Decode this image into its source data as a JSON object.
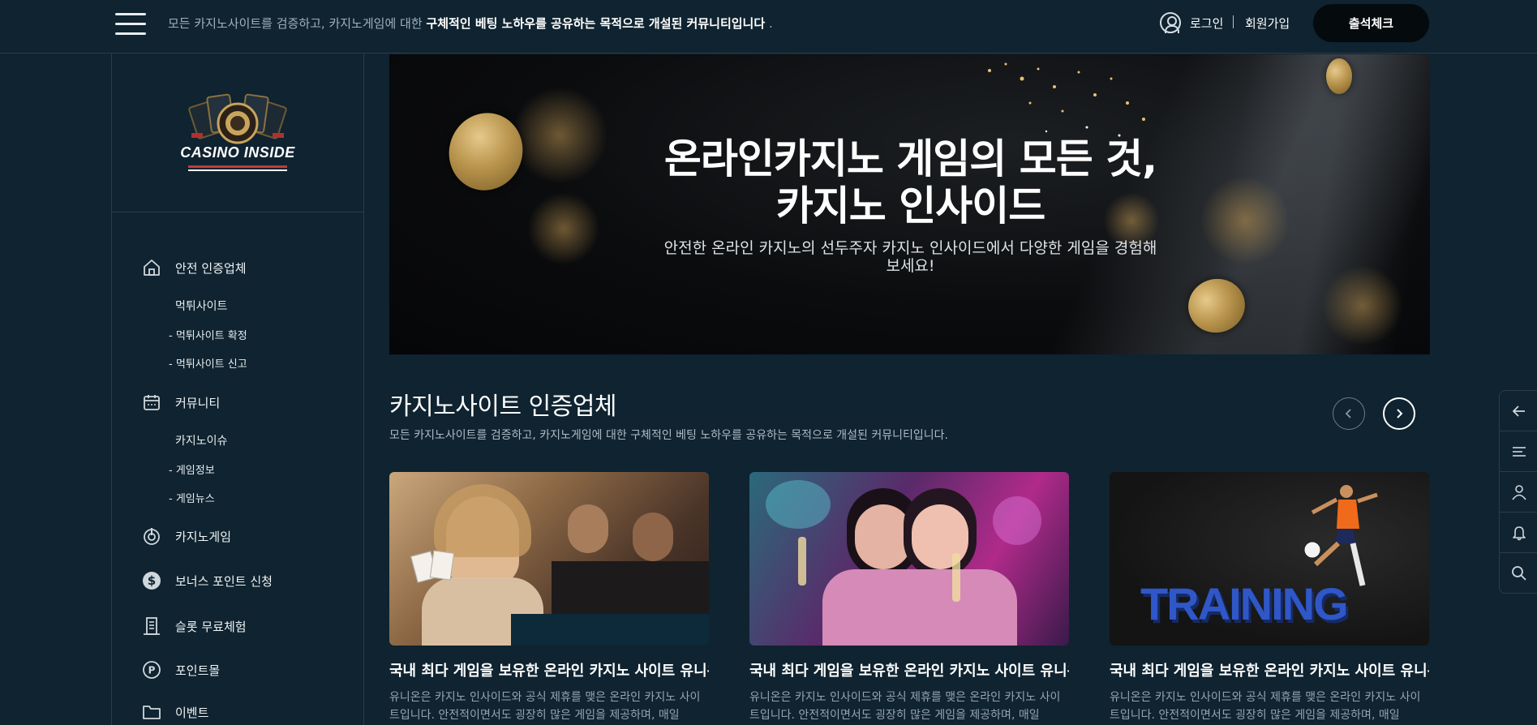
{
  "header": {
    "tagline_prefix": "모든 카지노사이트를 검증하고, 카지노게임에 대한 ",
    "tagline_bold": "구체적인 베팅 노하우를 공유하는 목적으로 개설된 커뮤니티입니다",
    "tagline_suffix": " .",
    "login": "로그인",
    "signup": "회원가입",
    "attendance": "출석체크"
  },
  "sidebar": {
    "logo_text": "CASINO INSIDE",
    "items": [
      {
        "label": "안전 인증업체",
        "icon": "home-icon"
      },
      {
        "label": "커뮤니티",
        "icon": "calendar-icon"
      },
      {
        "label": "카지노게임",
        "icon": "power-icon"
      },
      {
        "label": "보너스 포인트 신청",
        "icon": "dollar-icon"
      },
      {
        "label": "슬롯 무료체험",
        "icon": "building-icon"
      },
      {
        "label": "포인트몰",
        "icon": "point-icon"
      },
      {
        "label": "이벤트",
        "icon": "folder-icon"
      }
    ],
    "sub1": "먹튀사이트",
    "sub1_children": [
      "- 먹튀사이트 확정",
      "- 먹튀사이트 신고"
    ],
    "sub2": "카지노이슈",
    "sub2_children": [
      "- 게임정보",
      "- 게임뉴스"
    ]
  },
  "hero": {
    "title_line1": "온라인카지노 게임의 모든 것,",
    "title_line2": "카지노 인사이드",
    "subtitle": "안전한 온라인 카지노의 선두주자 카지노 인사이드에서 다양한 게임을 경험해보세요!"
  },
  "section": {
    "title": "카지노사이트 인증업체",
    "description": "모든 카지노사이트를 검증하고, 카지노게임에 대한 구체적인 베팅 노하우를 공유하는 목적으로 개설된 커뮤니티입니다."
  },
  "cards": [
    {
      "title": "국내 최다 게임을 보유한 온라인 카지노 사이트 유니온",
      "desc": "유니온은 카지노 인사이드와 공식 제휴를 맺은 온라인 카지노 사이트입니다. 안전적이면서도 굉장히 많은 게임을 제공하며, 매일",
      "image": "casino-players"
    },
    {
      "title": "국내 최다 게임을 보유한 온라인 카지노 사이트 유니온",
      "desc": "유니온은 카지노 인사이드와 공식 제휴를 맺은 온라인 카지노 사이트입니다. 안전적이면서도 굉장히 많은 게임을 제공하며, 매일",
      "image": "party-women"
    },
    {
      "title": "국내 최다 게임을 보유한 온라인 카지노 사이트 유니온",
      "desc": "유니온은 카지노 인사이드와 공식 제휴를 맺은 온라인 카지노 사이트입니다. 안전적이면서도 굉장히 많은 게임을 제공하며, 매일",
      "image": "training",
      "image_text": "TRAINING"
    }
  ],
  "rail": [
    "arrow-left-icon",
    "list-icon",
    "user-icon",
    "bell-icon",
    "search-icon"
  ],
  "colors": {
    "background": "#0f2330",
    "border": "#2a3d49",
    "button_dark": "#050a0d",
    "muted_text": "#96a5af"
  }
}
